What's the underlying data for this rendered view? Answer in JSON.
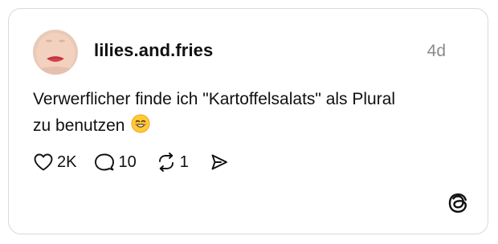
{
  "post": {
    "username": "lilies.and.fries",
    "time": "4d",
    "text_line1": "Verwerflicher finde ich \"Kartoffelsalats\" als Plural",
    "text_line2": "zu benutzen",
    "emoji": "smiling-face-with-smiling-eyes"
  },
  "actions": {
    "likes": "2K",
    "replies": "10",
    "reposts": "1"
  },
  "icons": {
    "like": "heart-icon",
    "reply": "speech-bubble-icon",
    "repost": "repost-icon",
    "share": "send-icon",
    "logo": "threads-logo"
  }
}
